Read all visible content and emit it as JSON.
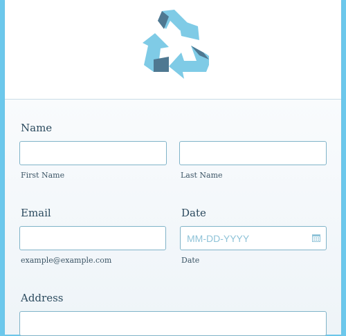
{
  "name_section": {
    "label": "Name",
    "first_sublabel": "First Name",
    "last_sublabel": "Last Name",
    "first_value": "",
    "last_value": ""
  },
  "email_section": {
    "label": "Email",
    "value": "",
    "sublabel": "example@example.com"
  },
  "date_section": {
    "label": "Date",
    "placeholder": "MM-DD-YYYY",
    "sublabel": "Date",
    "icon": "calendar-icon"
  },
  "address_section": {
    "label": "Address",
    "value": ""
  },
  "colors": {
    "background": "#6cc8ec",
    "accent": "#7fb3c8",
    "label_text": "#2b4a5e",
    "logo_light": "#7fcbe6",
    "logo_dark": "#4f7891"
  },
  "logo": {
    "icon": "recycle-icon"
  }
}
